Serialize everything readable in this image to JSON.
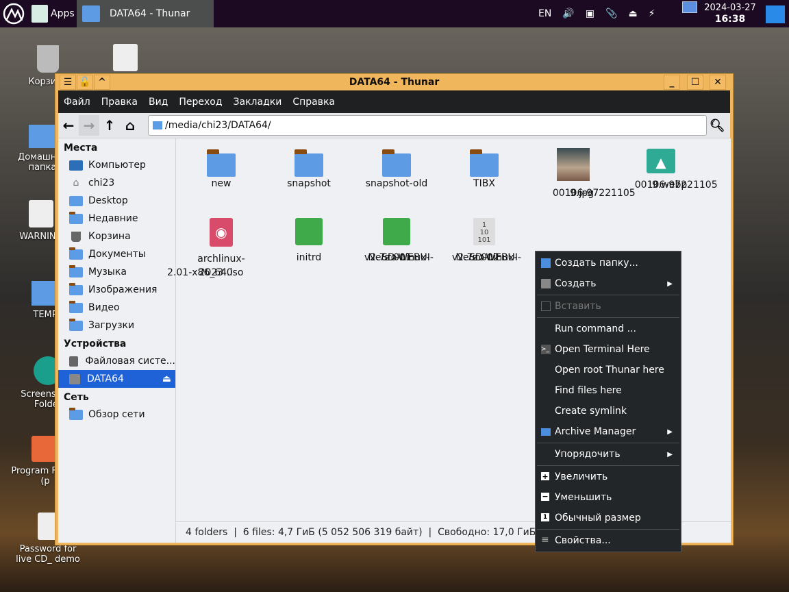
{
  "taskbar": {
    "apps_label": "Apps",
    "window_title": "DATA64 - Thunar",
    "lang": "EN",
    "date": "2024-03-27",
    "time": "16:38"
  },
  "desktop": {
    "icons": [
      {
        "label": "Корзина"
      },
      {
        "label": "Домашняя папка"
      },
      {
        "label": "WARNING"
      },
      {
        "label": "TEMP"
      },
      {
        "label": "Screenshots Folder"
      },
      {
        "label": "Program Folder (p"
      },
      {
        "label": "Password for live CD_ demo"
      }
    ]
  },
  "window": {
    "title": "DATA64 - Thunar",
    "menu": [
      "Файл",
      "Правка",
      "Вид",
      "Переход",
      "Закладки",
      "Справка"
    ],
    "path": "/media/chi23/DATA64/",
    "sidebar": {
      "places_title": "Места",
      "places": [
        "Компьютер",
        "chi23",
        "Desktop",
        "Недавние",
        "Корзина",
        "Документы",
        "Музыка",
        "Изображения",
        "Видео",
        "Загрузки"
      ],
      "devices_title": "Устройства",
      "devices": [
        "Файловая систе...",
        "DATA64"
      ],
      "network_title": "Сеть",
      "network": [
        "Обзор сети"
      ]
    },
    "files": [
      {
        "name": "new",
        "type": "folder"
      },
      {
        "name": "snapshot",
        "type": "folder"
      },
      {
        "name": "snapshot-old",
        "type": "folder"
      },
      {
        "name": "TIBX",
        "type": "folder"
      },
      {
        "name": "00106-97221105 9.jpg",
        "type": "image"
      },
      {
        "name": "00106-97221105 9.webp",
        "type": "image"
      },
      {
        "name": "archlinux-2023.0 2.01-x86_64.iso",
        "type": "iso"
      },
      {
        "name": "initrd",
        "type": "archive"
      },
      {
        "name": "SD-WEBUI- Neuro-Linux- v2.7z.001",
        "type": "archive"
      },
      {
        "name": "SD-WEBUI- Neuro-Linux- v2.7z.002",
        "type": "binary"
      }
    ],
    "status": "4 folders  |  6 files: 4,7 ГиБ (5 052 506 319 байт)  |  Свободно: 17,0 ГиБ"
  },
  "context_menu": [
    "Создать папку...",
    "Создать",
    "Вставить",
    "Run command ...",
    "Open Terminal Here",
    "Open root Thunar here",
    "Find files here",
    "Create symlink",
    "Archive Manager",
    "Упорядочить",
    "Увеличить",
    "Уменьшить",
    "Обычный размер",
    "Свойства..."
  ]
}
